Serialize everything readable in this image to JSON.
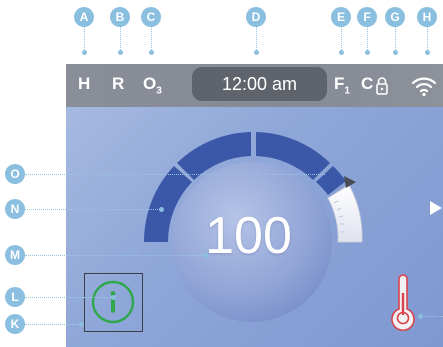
{
  "callouts": {
    "a": "A",
    "b": "B",
    "c": "C",
    "d": "D",
    "e": "E",
    "f": "F",
    "g": "G",
    "h": "H",
    "o": "O",
    "n": "N",
    "m": "M",
    "l": "L",
    "k": "K"
  },
  "statusbar": {
    "heater": "H",
    "recirc": "R",
    "ozone": "O",
    "ozone_sub": "3",
    "time": "12:00 am",
    "filter": "F",
    "filter_sub": "1",
    "cleanup": "C"
  },
  "main": {
    "temperature": "100",
    "set_level": 0.85
  },
  "colors": {
    "gauge_blue": "#3b58a8",
    "gauge_white": "#ffffff",
    "info_green": "#2ea84a",
    "thermo_red": "#d9434c",
    "callout": "#8bbfe0"
  },
  "icons": [
    "lock-icon",
    "wifi-icon",
    "info-icon",
    "thermometer-icon",
    "play-arrow-icon",
    "set-point-pointer-icon"
  ]
}
